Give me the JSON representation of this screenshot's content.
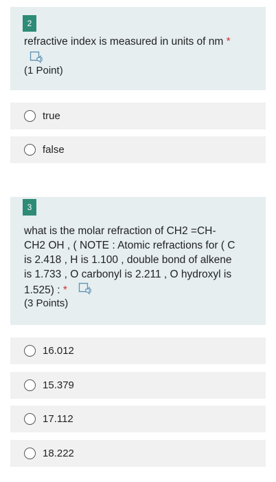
{
  "question2": {
    "number": "2",
    "text": "refractive index is measured in units of  nm",
    "required_mark": "*",
    "points": "(1 Point)",
    "options": [
      "true",
      "false"
    ]
  },
  "question3": {
    "number": "3",
    "text_lines": [
      "what is  the molar refraction of CH2 =CH-",
      "CH2 OH   , ( NOTE : Atomic refractions for ( C",
      "is 2.418 , H is 1.100 , double bond of alkene",
      "is 1.733 , O carbonyl  is 2.211 , O hydroxyl is",
      "1.525)    :"
    ],
    "required_mark": "*",
    "points": "(3 Points)",
    "options": [
      "16.012",
      "15.379",
      "17.112",
      "18.222"
    ]
  },
  "colors": {
    "card_background": "#e6eef0",
    "number_badge": "#2e8b76",
    "required": "#cc3333",
    "option_background": "#f1f1f1"
  },
  "icons": {
    "read_aloud": "immersive-reader-icon"
  }
}
